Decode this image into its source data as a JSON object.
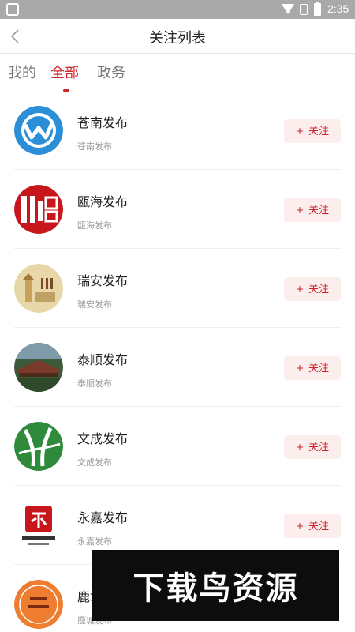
{
  "status_bar": {
    "time": "2:35"
  },
  "header": {
    "title": "关注列表"
  },
  "tabs": [
    {
      "label": "我的",
      "active": false
    },
    {
      "label": "全部",
      "active": true
    },
    {
      "label": "政务",
      "active": false
    }
  ],
  "follow_label": "关注",
  "items": [
    {
      "name": "苍南发布",
      "subtitle": "苍南发布",
      "avatar_icon": "cangnan-logo"
    },
    {
      "name": "瓯海发布",
      "subtitle": "瓯海发布",
      "avatar_icon": "ouhai-seal-logo"
    },
    {
      "name": "瑞安发布",
      "subtitle": "瑞安发布",
      "avatar_icon": "ruian-pagoda-logo"
    },
    {
      "name": "泰顺发布",
      "subtitle": "泰顺发布",
      "avatar_icon": "taishun-bridge-photo"
    },
    {
      "name": "文成发布",
      "subtitle": "文成发布",
      "avatar_icon": "wencheng-green-logo"
    },
    {
      "name": "永嘉发布",
      "subtitle": "永嘉发布",
      "avatar_icon": "yongjia-logo"
    },
    {
      "name": "鹿城发布",
      "subtitle": "鹿城发布",
      "avatar_icon": "lucheng-orange-logo"
    }
  ],
  "watermark": {
    "text": "下载鸟资源"
  },
  "colors": {
    "accent": "#d0232b",
    "follow_bg": "#fdeeee",
    "status_bar": "#a9a9a9"
  }
}
